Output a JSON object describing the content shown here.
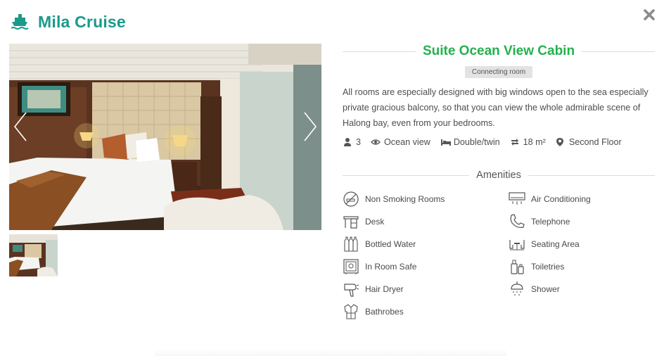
{
  "header": {
    "title": "Mila Cruise",
    "icon": "ship-icon",
    "accent": "#1a9a8a"
  },
  "close": {
    "icon": "close-icon"
  },
  "gallery": {
    "main_image": "cabin-photo",
    "prev_icon": "chevron-left-icon",
    "next_icon": "chevron-right-icon",
    "thumbnails": [
      "cabin-thumbnail"
    ]
  },
  "cabin": {
    "name": "Suite Ocean View Cabin",
    "name_color": "#22b24c",
    "tag": "Connecting room",
    "description": "All rooms are especially designed with big windows open to the sea especially private gracious balcony, so that you can view the whole admirable scene of Halong bay, even from your bedrooms.",
    "meta": {
      "guests": "3",
      "view": "Ocean view",
      "bed": "Double/twin",
      "size": "18 m²",
      "floor": "Second Floor"
    }
  },
  "amenities": {
    "title": "Amenities",
    "left": [
      {
        "label": "Non Smoking Rooms",
        "icon": "no-smoking-icon"
      },
      {
        "label": "Desk",
        "icon": "desk-icon"
      },
      {
        "label": "Bottled Water",
        "icon": "bottled-water-icon"
      },
      {
        "label": "In Room Safe",
        "icon": "safe-icon"
      },
      {
        "label": "Hair Dryer",
        "icon": "hair-dryer-icon"
      },
      {
        "label": "Bathrobes",
        "icon": "bathrobe-icon"
      }
    ],
    "right": [
      {
        "label": "Air Conditioning",
        "icon": "air-conditioner-icon"
      },
      {
        "label": "Telephone",
        "icon": "telephone-icon"
      },
      {
        "label": "Seating Area",
        "icon": "seating-area-icon"
      },
      {
        "label": "Toiletries",
        "icon": "toiletries-icon"
      },
      {
        "label": "Shower",
        "icon": "shower-icon"
      }
    ]
  }
}
